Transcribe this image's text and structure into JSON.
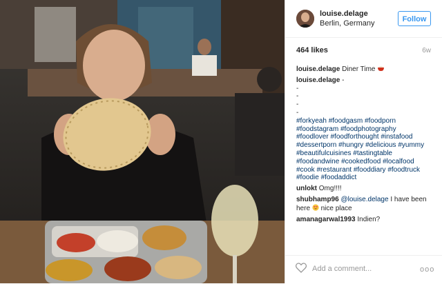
{
  "header": {
    "username": "louise.delage",
    "location": "Berlin, Germany",
    "follow_label": "Follow"
  },
  "stats": {
    "likes": "464 likes",
    "time_ago": "6w"
  },
  "caption": {
    "username": "louise.delage",
    "text": "Diner Time"
  },
  "tags_post": {
    "username": "louise.delage",
    "first": "-",
    "dashes": [
      "-",
      "-",
      "-",
      "-"
    ],
    "hashtags": [
      "#forkyeah",
      "#foodgasm",
      "#foodporn",
      "#foodstagram",
      "#foodphotography",
      "#foodlover",
      "#foodforthought",
      "#instafood",
      "#dessertporn",
      "#hungry",
      "#delicious",
      "#yummy",
      "#beautifulcuisines",
      "#tastingtable",
      "#foodandwine",
      "#cookedfood",
      "#localfood",
      "#cook",
      "#restaurant",
      "#fooddiary",
      "#foodtruck",
      "#foodie",
      "#foodaddict"
    ]
  },
  "comments": [
    {
      "username": "unlokt",
      "text": "Omg!!!!"
    },
    {
      "username": "shubhamp96",
      "mention": "@louise.delage",
      "text": "I have been here",
      "text2": "nice place"
    },
    {
      "username": "amanagarwal1993",
      "text": "Indien?"
    }
  ],
  "footer": {
    "add_comment_placeholder": "Add a comment...",
    "more_label": "ooo"
  },
  "icons": {
    "heart": "heart-icon",
    "more": "more-options-icon",
    "bowl": "bowl-emoji-icon",
    "heart_eyes": "heart-eyes-emoji-icon"
  },
  "colors": {
    "follow": "#3897f0",
    "tag": "#003569",
    "muted": "#999999"
  }
}
